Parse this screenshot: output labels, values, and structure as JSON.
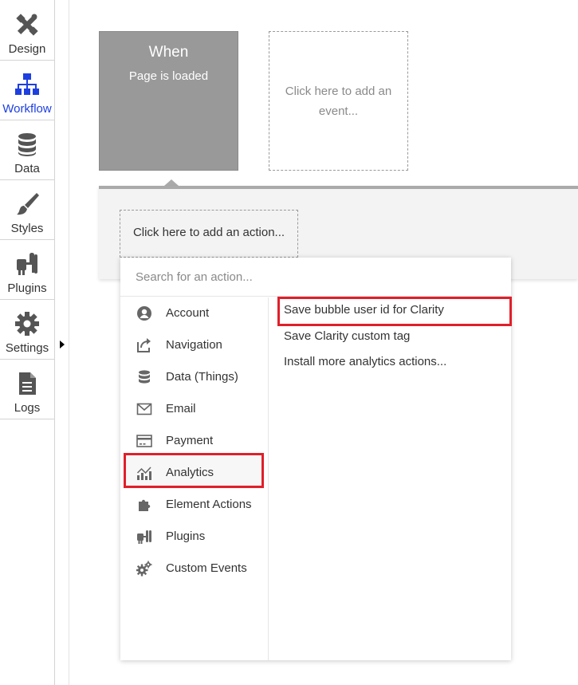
{
  "sidebar": {
    "items": [
      {
        "label": "Design",
        "icon": "design-icon"
      },
      {
        "label": "Workflow",
        "icon": "workflow-icon",
        "active": true
      },
      {
        "label": "Data",
        "icon": "database-icon"
      },
      {
        "label": "Styles",
        "icon": "brush-icon"
      },
      {
        "label": "Plugins",
        "icon": "plug-icon"
      },
      {
        "label": "Settings",
        "icon": "gear-icon"
      },
      {
        "label": "Logs",
        "icon": "document-icon"
      }
    ],
    "active_color": "#1e3fe0"
  },
  "events": {
    "card": {
      "title": "When",
      "subtitle": "Page is loaded"
    },
    "add_event_text": "Click here to add an event..."
  },
  "actions": {
    "add_action_text": "Click here to add an action..."
  },
  "picker": {
    "search_placeholder": "Search for an action...",
    "categories": [
      {
        "label": "Account",
        "icon": "account-icon"
      },
      {
        "label": "Navigation",
        "icon": "navigation-icon"
      },
      {
        "label": "Data (Things)",
        "icon": "database-icon"
      },
      {
        "label": "Email",
        "icon": "email-icon"
      },
      {
        "label": "Payment",
        "icon": "payment-icon"
      },
      {
        "label": "Analytics",
        "icon": "analytics-icon",
        "selected": true
      },
      {
        "label": "Element Actions",
        "icon": "element-actions-icon"
      },
      {
        "label": "Plugins",
        "icon": "plug-icon"
      },
      {
        "label": "Custom Events",
        "icon": "gears-icon"
      }
    ],
    "analytics_actions": [
      {
        "label": "Save bubble user id for Clarity"
      },
      {
        "label": "Save Clarity custom tag"
      },
      {
        "label": "Install more analytics actions..."
      }
    ],
    "highlight_color": "#e01f2a"
  }
}
